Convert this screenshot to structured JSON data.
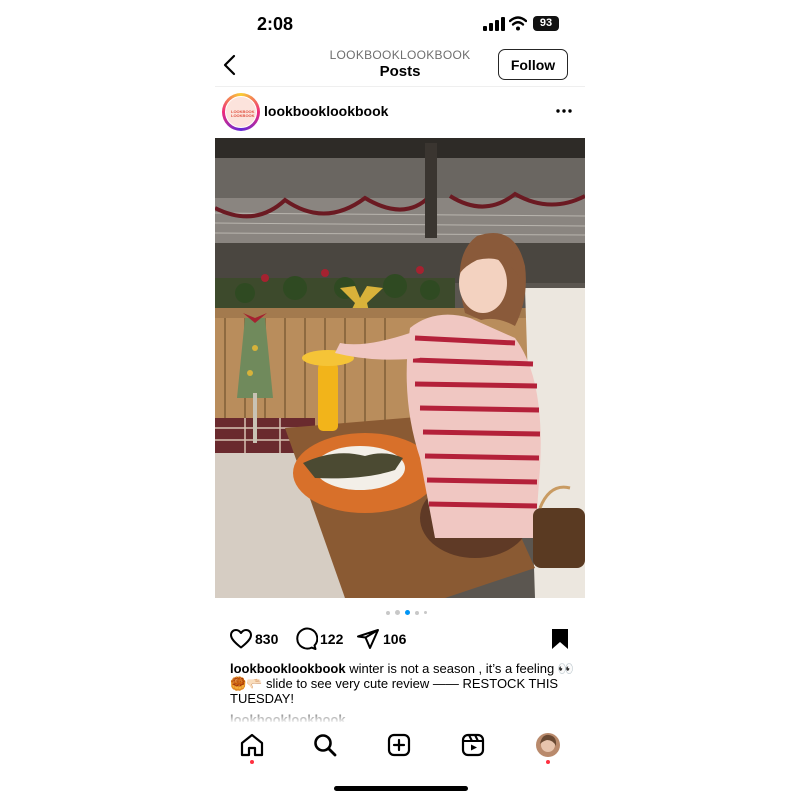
{
  "status": {
    "time": "2:08",
    "battery": "93"
  },
  "header": {
    "subtitle": "LOOKBOOKLOOKBOOK",
    "title": "Posts",
    "follow_label": "Follow"
  },
  "post": {
    "username": "lookbooklookbook",
    "avatar_text": "LOOKBOOK LOOKBOOK",
    "likes": "830",
    "comments": "122",
    "shares": "106",
    "carousel": {
      "count": 5,
      "active_index": 2
    },
    "caption_user": "lookbooklookbook",
    "caption_text": "winter is not a season , it’s a feeling 👀🥮🫳🏻 slide to see very cute review —— RESTOCK THIS TUESDAY!"
  },
  "icons": [
    "back-icon",
    "more-icon",
    "heart-icon",
    "comment-icon",
    "share-icon",
    "bookmark-icon",
    "home-icon",
    "search-icon",
    "create-icon",
    "reels-icon",
    "profile-icon"
  ],
  "colors": {
    "accent": "#0095f6",
    "notification": "#ff3040",
    "stripe": "#b4213a",
    "lamp": "#f2b41a"
  }
}
